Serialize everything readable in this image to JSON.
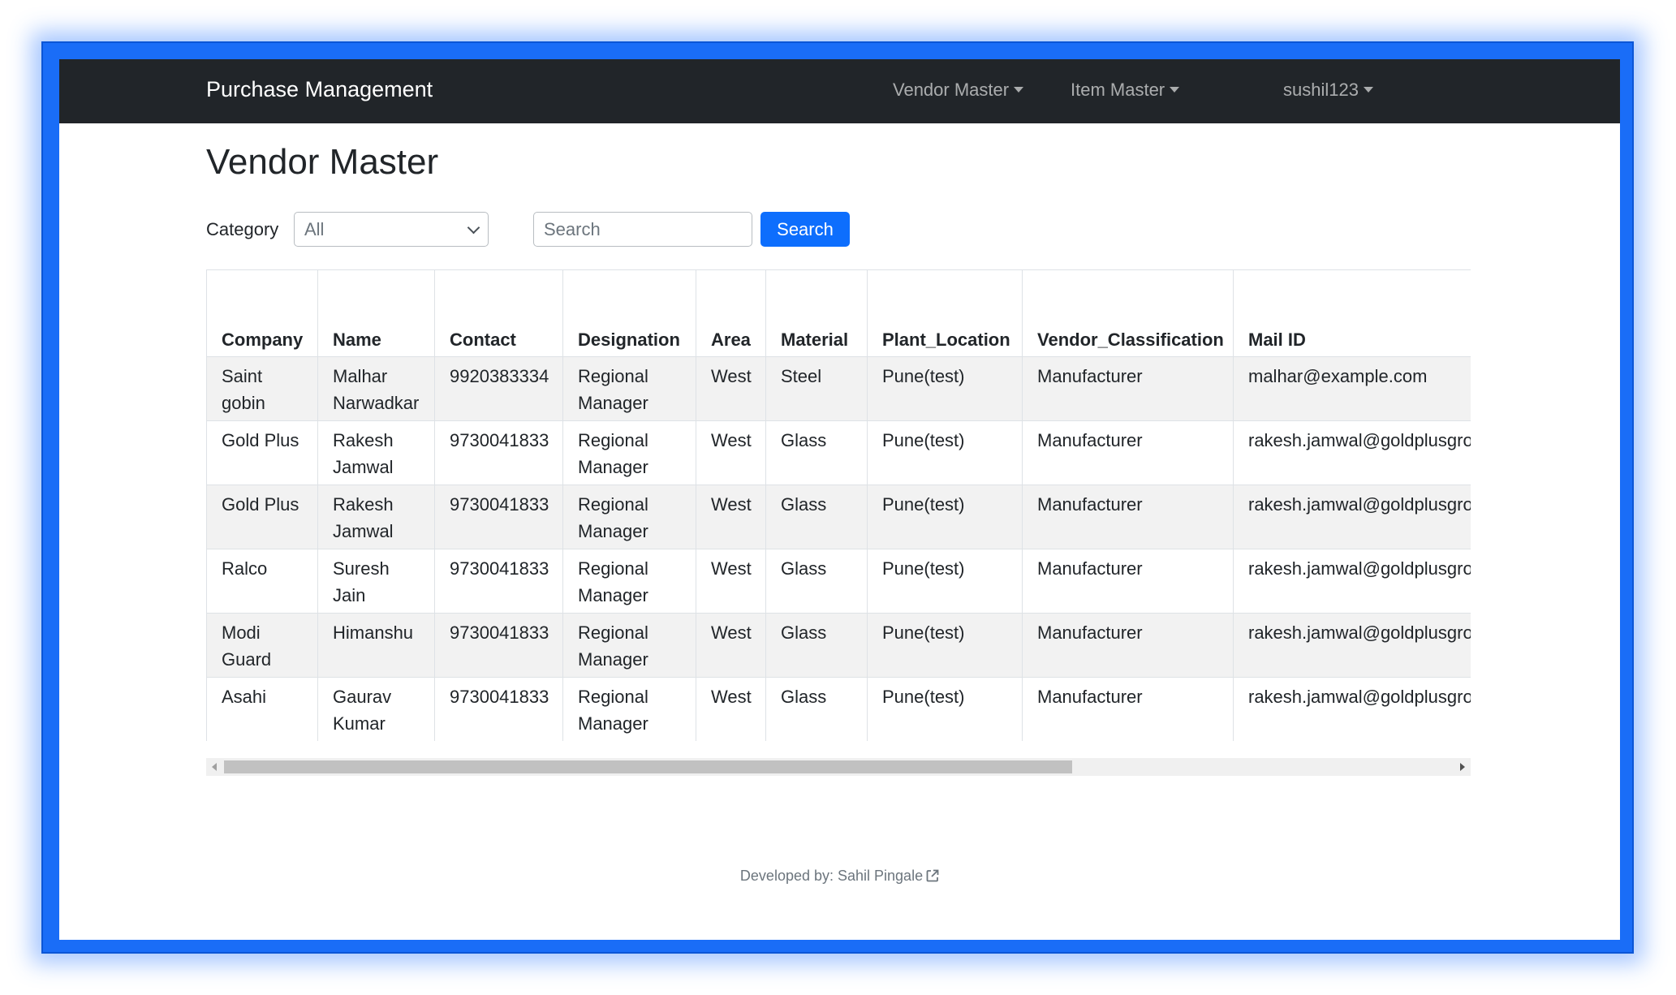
{
  "navbar": {
    "brand": "Purchase Management",
    "menus": [
      "Vendor Master",
      "Item Master",
      "sushil123"
    ]
  },
  "page": {
    "title": "Vendor Master"
  },
  "filters": {
    "category_label": "Category",
    "category_selected": "All",
    "search_placeholder": "Search",
    "search_button": "Search"
  },
  "table": {
    "columns": [
      "Company",
      "Name",
      "Contact",
      "Designation",
      "Area",
      "Material",
      "Plant_Location",
      "Vendor_Classification",
      "Mail ID"
    ],
    "rows": [
      [
        "Saint gobin",
        "Malhar Narwadkar",
        "9920383334",
        "Regional Manager",
        "West",
        "Steel",
        "Pune(test)",
        "Manufacturer",
        "malhar@example.com"
      ],
      [
        "Gold Plus",
        "Rakesh Jamwal",
        "9730041833",
        "Regional Manager",
        "West",
        "Glass",
        "Pune(test)",
        "Manufacturer",
        "rakesh.jamwal@goldplusgroup.com"
      ],
      [
        "Gold Plus",
        "Rakesh Jamwal",
        "9730041833",
        "Regional Manager",
        "West",
        "Glass",
        "Pune(test)",
        "Manufacturer",
        "rakesh.jamwal@goldplusgroup.com"
      ],
      [
        "Ralco",
        "Suresh Jain",
        "9730041833",
        "Regional Manager",
        "West",
        "Glass",
        "Pune(test)",
        "Manufacturer",
        "rakesh.jamwal@goldplusgroup.com"
      ],
      [
        "Modi Guard",
        "Himanshu",
        "9730041833",
        "Regional Manager",
        "West",
        "Glass",
        "Pune(test)",
        "Manufacturer",
        "rakesh.jamwal@goldplusgroup.com"
      ],
      [
        "Asahi",
        "Gaurav Kumar",
        "9730041833",
        "Regional Manager",
        "West",
        "Glass",
        "Pune(test)",
        "Manufacturer",
        "rakesh.jamwal@goldplusgroup.com"
      ]
    ]
  },
  "scrollbar": {
    "position": 0,
    "visible_fraction": 0.69
  },
  "footer": {
    "prefix": "Developed by: ",
    "author": "Sahil Pingale",
    "icon": "external-link-icon"
  },
  "colors": {
    "frame": "#1a6df7",
    "navbar": "#212529",
    "primary": "#0d6efd",
    "stripe": "#f2f2f2"
  }
}
